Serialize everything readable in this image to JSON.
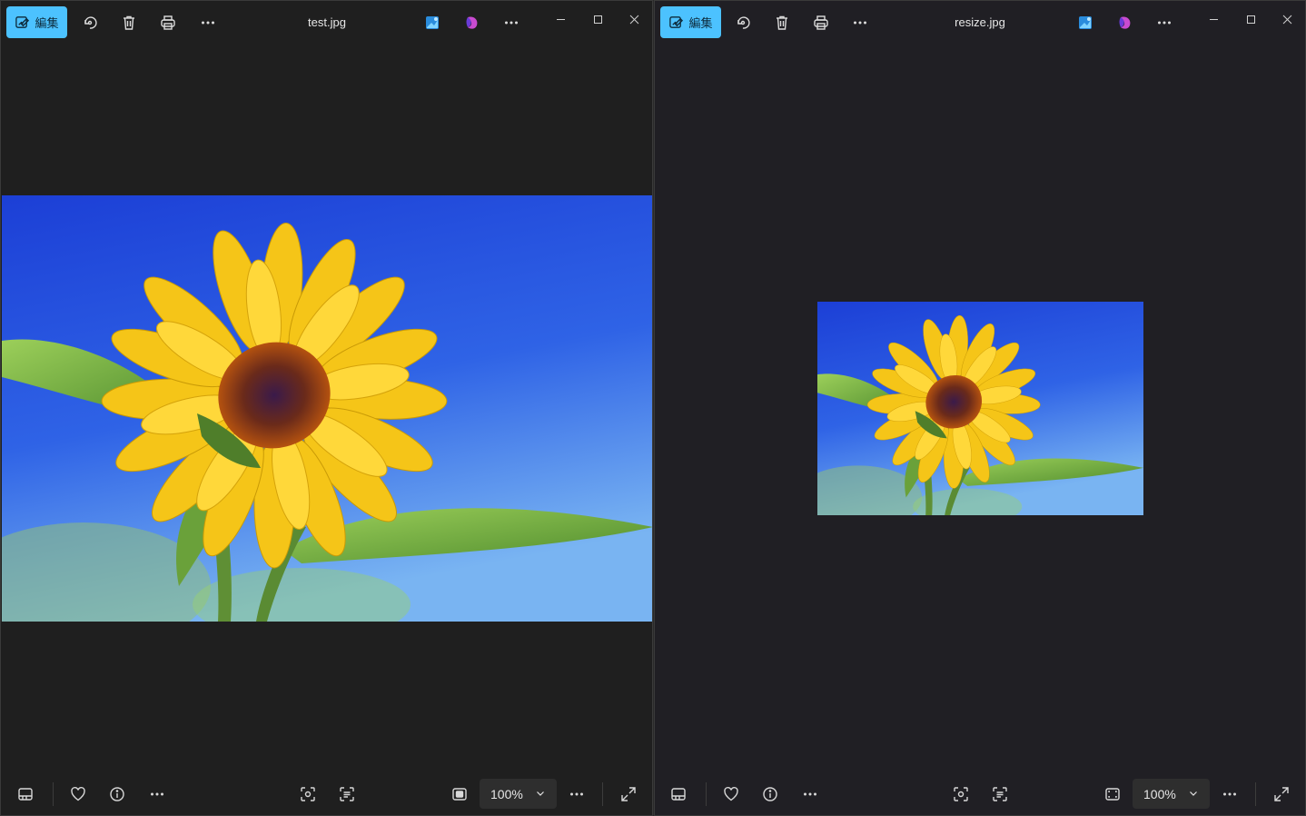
{
  "colors": {
    "accent": "#4cc2ff",
    "window_bg_left": "#1f1f1f",
    "window_bg_right": "#201f24"
  },
  "left_window": {
    "title": "test.jpg",
    "edit_label": "編集",
    "zoom": "100%"
  },
  "right_window": {
    "title": "resize.jpg",
    "edit_label": "編集",
    "zoom": "100%"
  },
  "icons": {
    "edit": "edit-image-icon",
    "rotate": "rotate-icon",
    "delete": "trash-icon",
    "print": "print-icon",
    "more": "more-icon",
    "photos_editor": "photos-editor-icon",
    "clipchamp": "clipchamp-icon",
    "filmstrip": "filmstrip-icon",
    "favorite": "heart-icon",
    "info": "info-icon",
    "visual_search": "visual-search-icon",
    "ocr": "text-scan-icon",
    "fit": "fit-icon",
    "fullscreen": "fullscreen-icon"
  }
}
